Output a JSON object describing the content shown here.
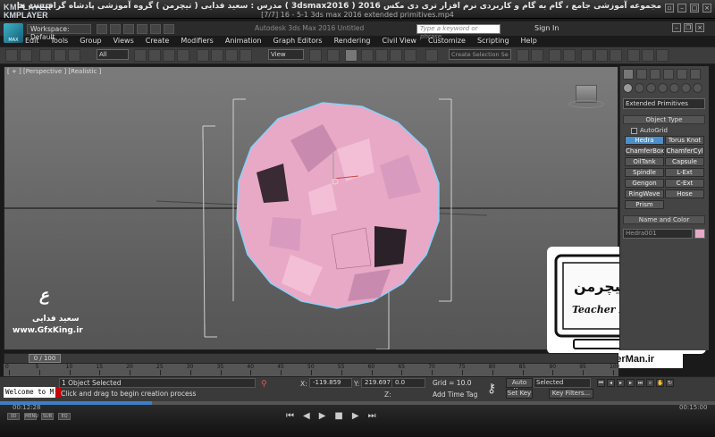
{
  "kmplayer": {
    "logo": "KMPLAYER",
    "title": "مجموعه آموزشی جامع ، گام به گام و کاربردی نرم افزار تری دی مکس 2016 ( 3dsmax2016 ) مدرس : سعید فدایی ( تیچرمن ) گروه آموزشی پادشاه گرافیست ها",
    "file": "[7/7] 16 - 5-1 3ds max 2016 extended primitives.mp4",
    "time_current": "00:12:28",
    "time_total": "00:15:00",
    "left_buttons": [
      "3D",
      "MENU",
      "SUB",
      "EQ"
    ]
  },
  "app": {
    "icon_label": "MAX",
    "workspace": "Workspace: Default",
    "title": "Autodesk 3ds Max 2016    Untitled",
    "search_placeholder": "Type a keyword or phrase",
    "sign_in": "Sign In"
  },
  "menu": [
    "Edit",
    "Tools",
    "Group",
    "Views",
    "Create",
    "Modifiers",
    "Animation",
    "Graph Editors",
    "Rendering",
    "Civil View",
    "Customize",
    "Scripting",
    "Help"
  ],
  "toolbar": {
    "selection_filter": "All",
    "reference_coord": "View",
    "selection_set_placeholder": "Create Selection Se"
  },
  "viewport": {
    "label": "[ + ] [Perspective ] [Realistic ]",
    "object_color": "#e8a9c6",
    "selection_color": "#7fd4ff"
  },
  "watermark": {
    "signature": "ﻉ",
    "name": "سعید فدایی",
    "url": "www.GfxKing.ir"
  },
  "teacher": {
    "badge_title": "تیچرمن",
    "badge_name": "Teacher Man",
    "url": "www.TeacherMan.ir"
  },
  "command_panel": {
    "category": "Extended Primitives",
    "object_type_title": "Object Type",
    "autogrid": "AutoGrid",
    "buttons": [
      [
        "Hedra",
        "Torus Knot"
      ],
      [
        "ChamferBox",
        "ChamferCyl"
      ],
      [
        "OilTank",
        "Capsule"
      ],
      [
        "Spindle",
        "L-Ext"
      ],
      [
        "Gengon",
        "C-Ext"
      ],
      [
        "RingWave",
        "Hose"
      ],
      [
        "Prism",
        ""
      ]
    ],
    "active_button": "Hedra",
    "name_color_title": "Name and Color",
    "name_value": "Hedra001"
  },
  "timeline": {
    "frame": "0 / 100",
    "ticks": [
      "0",
      "5",
      "10",
      "15",
      "20",
      "25",
      "30",
      "35",
      "40",
      "45",
      "50",
      "55",
      "60",
      "65",
      "70",
      "75",
      "80",
      "85",
      "90",
      "95",
      "100"
    ]
  },
  "status": {
    "maxscript": "Welcome to M",
    "selected": "1 Object Selected",
    "prompt": "Click and drag to begin creation process",
    "x_label": "X:",
    "x_value": "-119.859",
    "y_label": "Y:",
    "y_value": "219.697",
    "z_label": "Z:",
    "z_value": "0.0",
    "grid": "Grid = 10.0",
    "add_time_tag": "Add Time Tag",
    "auto_key": "Auto Key",
    "set_key": "Set Key",
    "key_mode": "Selected",
    "key_filters": "Key Filters..."
  }
}
